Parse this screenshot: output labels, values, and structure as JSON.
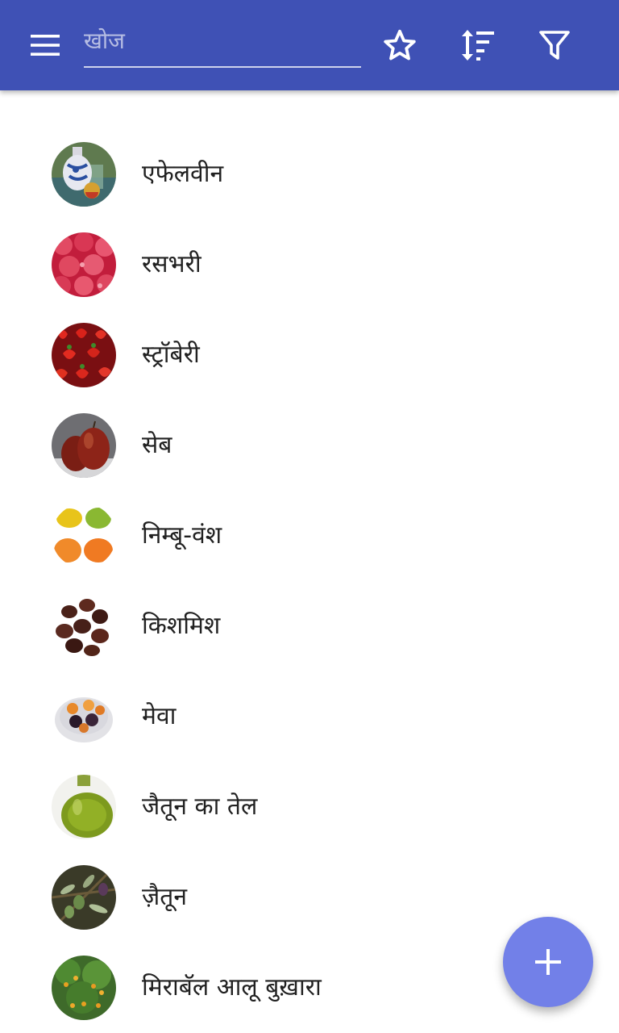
{
  "search": {
    "placeholder": "खोज",
    "value": ""
  },
  "toolbar": {
    "color": "#3f51b5",
    "icons": [
      "menu-icon",
      "star-icon",
      "sort-icon",
      "filter-icon"
    ]
  },
  "items": [
    {
      "label": "एफेलवीन",
      "thumb_icon": "cider-jug-icon"
    },
    {
      "label": "रसभरी",
      "thumb_icon": "raspberries-icon"
    },
    {
      "label": "स्ट्रॉबेरी",
      "thumb_icon": "strawberries-icon"
    },
    {
      "label": "सेब",
      "thumb_icon": "apple-icon"
    },
    {
      "label": "निम्बू-वंश",
      "thumb_icon": "citrus-icon"
    },
    {
      "label": "किशमिश",
      "thumb_icon": "raisins-icon"
    },
    {
      "label": "मेवा",
      "thumb_icon": "dried-fruit-bowl-icon"
    },
    {
      "label": "जैतून का तेल",
      "thumb_icon": "olive-oil-bottle-icon"
    },
    {
      "label": "ज़ैतून",
      "thumb_icon": "olive-branch-icon"
    },
    {
      "label": "मिराबॅल आलू बुख़ारा",
      "thumb_icon": "mirabelle-tree-icon"
    }
  ],
  "fab": {
    "icon": "plus-icon",
    "color": "#7280e8"
  }
}
